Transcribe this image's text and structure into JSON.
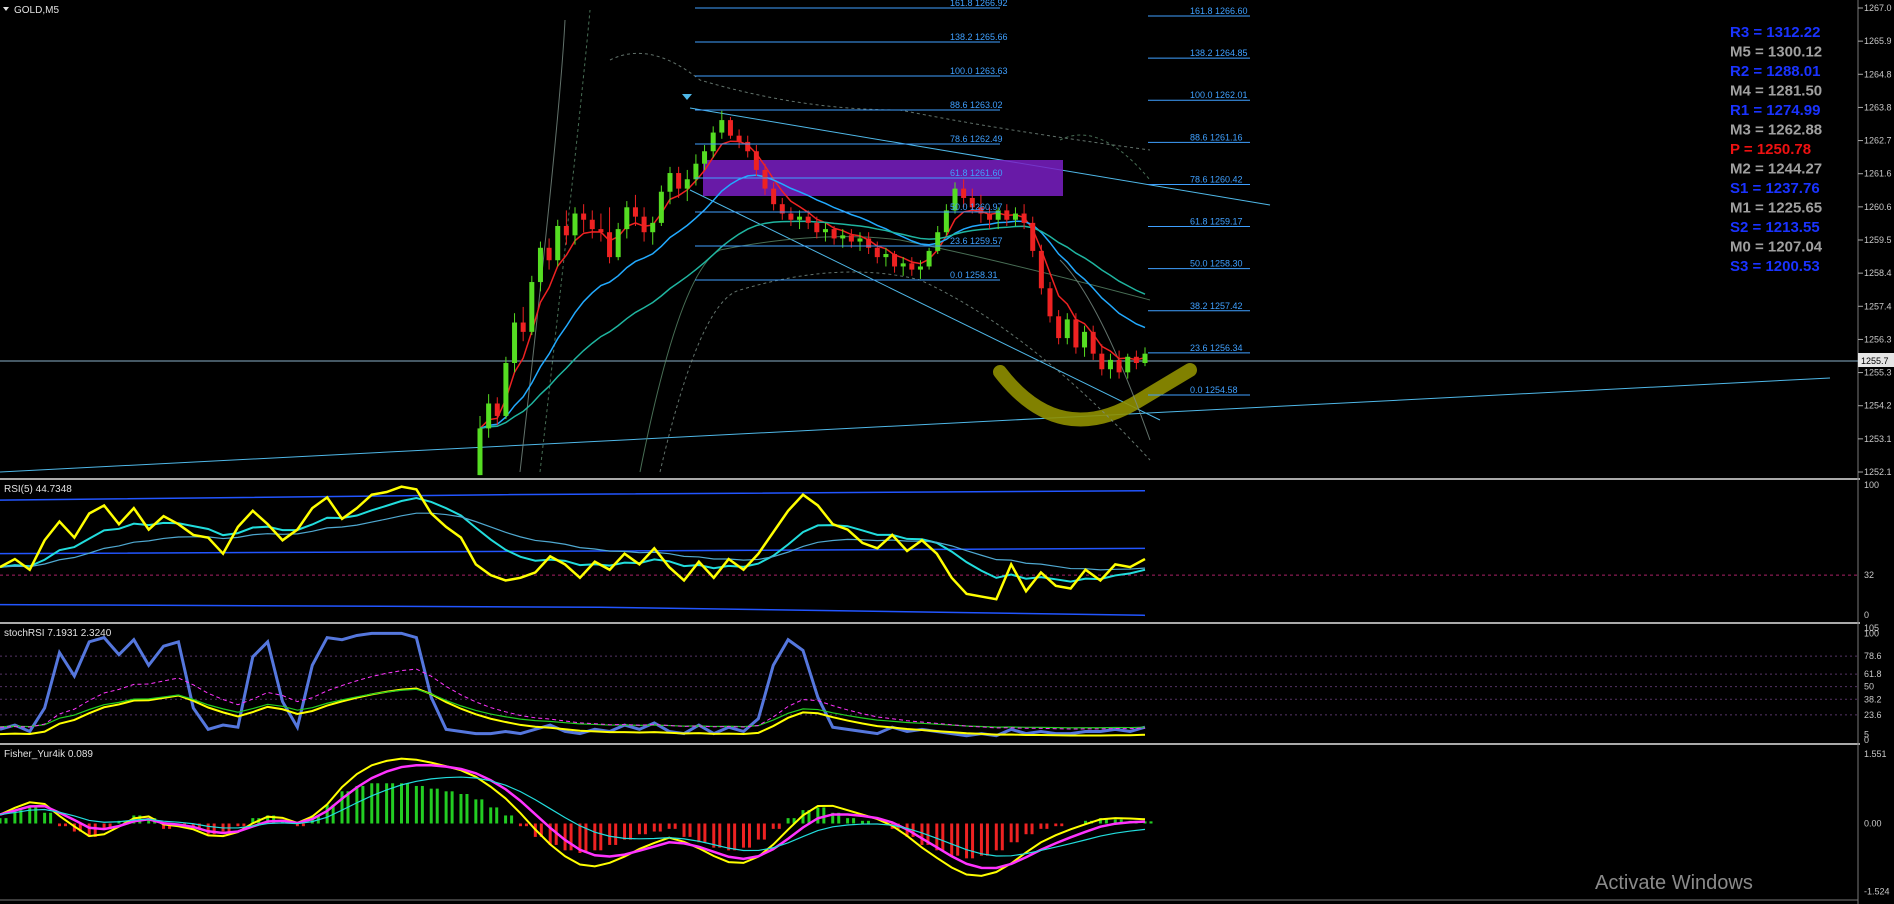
{
  "symbol": "GOLD,M5",
  "watermark": "Activate Windows",
  "colors": {
    "background": "#000000",
    "bull": "#55dd22",
    "bear": "#ee2222",
    "fib": "#3fa0ff",
    "trend": "#4fb8e8",
    "zone": "#7a1fc4",
    "marker": "#8f8f00",
    "yellow": "#ffff00",
    "magenta": "#ff33ff",
    "cyan": "#22dddd",
    "blue": "#2255ff",
    "steelblue": "#5577dd",
    "green": "#22cc22",
    "pivot_r": "#1a33ff",
    "pivot_m": "#a0a0a0",
    "pivot_p": "#ee1111",
    "pivot_s": "#1a33ff"
  },
  "price_axis": {
    "ticks": [
      "1267.0",
      "1265.9",
      "1264.8",
      "1263.8",
      "1262.7",
      "1261.6",
      "1260.6",
      "1259.5",
      "1258.4",
      "1257.4",
      "1256.3",
      "1255.3",
      "1254.2",
      "1253.1",
      "1252.1"
    ],
    "current_price": "1255.7"
  },
  "fib_set_1": [
    {
      "label": "161.8 1266.92"
    },
    {
      "label": "138.2  1265.66"
    },
    {
      "label": "100.0 1263.63"
    },
    {
      "label": "88.6 1263.02"
    },
    {
      "label": "78.6 1262.49"
    },
    {
      "label": "61.8 1261.60"
    },
    {
      "label": "50.0 1260.97"
    },
    {
      "label": "23.6 1259.57"
    },
    {
      "label": "0.0 1258.31"
    }
  ],
  "fib_set_2": [
    {
      "label": "161.8 1266.60"
    },
    {
      "label": "138.2  1264.85"
    },
    {
      "label": "100.0 1262.01"
    },
    {
      "label": "88.6 1261.16"
    },
    {
      "label": "78.6 1260.42"
    },
    {
      "label": "61.8 1259.17"
    },
    {
      "label": "50.0 1258.30"
    },
    {
      "label": "38.2 1257.42"
    },
    {
      "label": "23.6 1256.34"
    },
    {
      "label": "0.0 1254.58"
    }
  ],
  "pivots": [
    {
      "label": "R3 = 1312.22",
      "kind": "r"
    },
    {
      "label": "M5 = 1300.12",
      "kind": "m"
    },
    {
      "label": "R2 = 1288.01",
      "kind": "r"
    },
    {
      "label": "M4 = 1281.50",
      "kind": "m"
    },
    {
      "label": "R1 = 1274.99",
      "kind": "r"
    },
    {
      "label": "M3 = 1262.88",
      "kind": "m"
    },
    {
      "label": "P   = 1250.78",
      "kind": "p"
    },
    {
      "label": "M2 = 1244.27",
      "kind": "m"
    },
    {
      "label": "S1 = 1237.76",
      "kind": "s"
    },
    {
      "label": "M1 = 1225.65",
      "kind": "m"
    },
    {
      "label": "S2 = 1213.55",
      "kind": "s"
    },
    {
      "label": "M0 = 1207.04",
      "kind": "m"
    },
    {
      "label": "S3 = 1200.53",
      "kind": "s"
    }
  ],
  "rsi_pane": {
    "title": "RSI(5) 44.7348",
    "ticks": [
      "100",
      "32",
      "0"
    ]
  },
  "stoch_pane": {
    "title": "stochRSI 7.1931 2.3240",
    "ticks": [
      "105",
      "100",
      "78.6",
      "61.8",
      "50",
      "38.2",
      "23.6",
      "5",
      "0"
    ]
  },
  "fisher_pane": {
    "title": "Fisher_Yur4ik 0.089",
    "ticks": [
      "1.551",
      "0.00",
      "-1.524"
    ]
  },
  "chart_data": {
    "type": "line",
    "title": "GOLD,M5",
    "ylim": [
      1252.1,
      1267.0
    ],
    "candles": [
      [
        1252.0,
        1253.9,
        1252.0,
        1253.5
      ],
      [
        1253.5,
        1254.6,
        1253.2,
        1254.3
      ],
      [
        1254.3,
        1254.5,
        1253.6,
        1253.9
      ],
      [
        1253.9,
        1255.8,
        1253.8,
        1255.6
      ],
      [
        1255.6,
        1257.2,
        1255.3,
        1256.9
      ],
      [
        1256.9,
        1257.4,
        1256.3,
        1256.6
      ],
      [
        1256.6,
        1258.4,
        1256.5,
        1258.2
      ],
      [
        1258.2,
        1259.5,
        1257.9,
        1259.3
      ],
      [
        1259.3,
        1259.6,
        1258.6,
        1258.9
      ],
      [
        1258.9,
        1260.2,
        1258.7,
        1260.0
      ],
      [
        1260.0,
        1260.5,
        1259.4,
        1259.7
      ],
      [
        1259.7,
        1260.6,
        1259.4,
        1260.4
      ],
      [
        1260.4,
        1260.7,
        1259.8,
        1260.2
      ],
      [
        1260.2,
        1260.5,
        1259.6,
        1259.9
      ],
      [
        1259.9,
        1260.4,
        1259.5,
        1259.8
      ],
      [
        1259.8,
        1260.6,
        1258.8,
        1259.0
      ],
      [
        1259.0,
        1260.1,
        1258.9,
        1259.9
      ],
      [
        1259.9,
        1260.8,
        1259.6,
        1260.6
      ],
      [
        1260.6,
        1261.0,
        1260.0,
        1260.3
      ],
      [
        1260.3,
        1260.6,
        1259.5,
        1259.8
      ],
      [
        1259.8,
        1260.3,
        1259.4,
        1260.1
      ],
      [
        1260.1,
        1261.3,
        1260.0,
        1261.1
      ],
      [
        1261.1,
        1261.9,
        1260.7,
        1261.7
      ],
      [
        1261.7,
        1261.9,
        1260.9,
        1261.2
      ],
      [
        1261.2,
        1261.8,
        1260.8,
        1261.5
      ],
      [
        1261.5,
        1262.3,
        1261.3,
        1262.0
      ],
      [
        1262.0,
        1262.6,
        1261.8,
        1262.4
      ],
      [
        1262.4,
        1263.2,
        1262.2,
        1263.0
      ],
      [
        1263.0,
        1263.7,
        1262.8,
        1263.4
      ],
      [
        1263.4,
        1263.5,
        1262.8,
        1262.9
      ],
      [
        1262.9,
        1263.1,
        1262.5,
        1262.7
      ],
      [
        1262.7,
        1262.9,
        1262.2,
        1262.4
      ],
      [
        1262.4,
        1262.6,
        1261.6,
        1261.8
      ],
      [
        1261.8,
        1262.0,
        1261.0,
        1261.2
      ],
      [
        1261.2,
        1261.4,
        1260.5,
        1260.7
      ],
      [
        1260.7,
        1260.9,
        1260.2,
        1260.4
      ],
      [
        1260.4,
        1260.6,
        1260.0,
        1260.2
      ],
      [
        1260.2,
        1260.5,
        1259.9,
        1260.3
      ],
      [
        1260.3,
        1260.5,
        1259.9,
        1260.1
      ],
      [
        1260.1,
        1260.3,
        1259.6,
        1259.8
      ],
      [
        1259.8,
        1260.1,
        1259.5,
        1259.9
      ],
      [
        1259.9,
        1260.0,
        1259.4,
        1259.6
      ],
      [
        1259.6,
        1259.9,
        1259.3,
        1259.7
      ],
      [
        1259.7,
        1259.9,
        1259.3,
        1259.5
      ],
      [
        1259.5,
        1259.8,
        1259.2,
        1259.6
      ],
      [
        1259.6,
        1259.8,
        1259.1,
        1259.3
      ],
      [
        1259.3,
        1259.5,
        1258.8,
        1259.0
      ],
      [
        1259.0,
        1259.3,
        1258.7,
        1259.1
      ],
      [
        1259.1,
        1259.2,
        1258.5,
        1258.7
      ],
      [
        1258.7,
        1259.0,
        1258.4,
        1258.8
      ],
      [
        1258.8,
        1259.0,
        1258.4,
        1258.6
      ],
      [
        1258.6,
        1258.9,
        1258.3,
        1258.7
      ],
      [
        1258.7,
        1259.3,
        1258.6,
        1259.2
      ],
      [
        1259.2,
        1260.0,
        1259.1,
        1259.8
      ],
      [
        1259.8,
        1260.7,
        1259.7,
        1260.5
      ],
      [
        1260.5,
        1261.4,
        1260.4,
        1261.2
      ],
      [
        1261.2,
        1261.5,
        1260.6,
        1260.9
      ],
      [
        1260.9,
        1261.2,
        1260.4,
        1260.6
      ],
      [
        1260.6,
        1261.0,
        1260.1,
        1260.4
      ],
      [
        1260.4,
        1260.6,
        1259.9,
        1260.2
      ],
      [
        1260.2,
        1260.6,
        1259.9,
        1260.5
      ],
      [
        1260.5,
        1260.7,
        1260.0,
        1260.2
      ],
      [
        1260.2,
        1260.6,
        1260.0,
        1260.4
      ],
      [
        1260.4,
        1260.7,
        1259.9,
        1260.1
      ],
      [
        1260.1,
        1260.3,
        1259.0,
        1259.2
      ],
      [
        1259.2,
        1259.4,
        1257.8,
        1258.0
      ],
      [
        1258.0,
        1258.2,
        1256.9,
        1257.1
      ],
      [
        1257.1,
        1257.3,
        1256.2,
        1256.4
      ],
      [
        1256.4,
        1257.2,
        1256.2,
        1257.0
      ],
      [
        1257.0,
        1257.2,
        1255.9,
        1256.1
      ],
      [
        1256.1,
        1256.8,
        1255.8,
        1256.6
      ],
      [
        1256.6,
        1256.8,
        1255.7,
        1255.9
      ],
      [
        1255.9,
        1256.2,
        1255.2,
        1255.4
      ],
      [
        1255.4,
        1255.9,
        1255.1,
        1255.7
      ],
      [
        1255.7,
        1256.0,
        1255.1,
        1255.3
      ],
      [
        1255.3,
        1255.9,
        1255.1,
        1255.8
      ],
      [
        1255.8,
        1256.0,
        1255.4,
        1255.6
      ],
      [
        1255.6,
        1256.1,
        1255.5,
        1255.9
      ]
    ],
    "rsi": [
      38,
      44,
      36,
      58,
      72,
      60,
      78,
      84,
      70,
      82,
      66,
      76,
      70,
      62,
      60,
      48,
      68,
      80,
      70,
      58,
      66,
      82,
      90,
      74,
      82,
      92,
      94,
      98,
      96,
      78,
      68,
      60,
      40,
      32,
      28,
      30,
      34,
      46,
      40,
      30,
      42,
      36,
      48,
      40,
      52,
      38,
      28,
      42,
      30,
      44,
      36,
      48,
      64,
      80,
      92,
      84,
      70,
      66,
      56,
      52,
      62,
      50,
      58,
      48,
      30,
      18,
      16,
      14,
      40,
      20,
      34,
      24,
      22,
      36,
      28,
      40,
      38,
      44
    ],
    "stoch": [
      10,
      14,
      8,
      30,
      82,
      60,
      92,
      96,
      80,
      94,
      70,
      88,
      92,
      30,
      10,
      14,
      12,
      78,
      92,
      36,
      12,
      70,
      96,
      94,
      98,
      100,
      100,
      100,
      96,
      40,
      10,
      8,
      6,
      6,
      8,
      6,
      10,
      14,
      8,
      6,
      10,
      8,
      14,
      10,
      16,
      8,
      6,
      14,
      6,
      12,
      8,
      20,
      70,
      94,
      84,
      40,
      12,
      10,
      8,
      6,
      12,
      8,
      10,
      8,
      6,
      4,
      6,
      4,
      10,
      6,
      8,
      6,
      6,
      8,
      8,
      10,
      8,
      12
    ],
    "fisher": [
      0.2,
      0.5,
      0.6,
      0.4,
      -0.1,
      -0.3,
      -0.5,
      -0.2,
      0.1,
      0.3,
      0.2,
      -0.2,
      -0.1,
      -0.2,
      -0.4,
      -0.3,
      -0.1,
      0.2,
      0.3,
      0.1,
      -0.1,
      0.3,
      0.7,
      1.2,
      1.4,
      1.5,
      1.5,
      1.5,
      1.4,
      1.3,
      1.2,
      1.1,
      0.9,
      0.6,
      0.3,
      -0.1,
      -0.5,
      -0.8,
      -1.0,
      -1.1,
      -1.0,
      -0.8,
      -0.6,
      -0.4,
      -0.3,
      -0.2,
      -0.5,
      -0.7,
      -0.9,
      -1.0,
      -0.9,
      -0.6,
      -0.2,
      0.2,
      0.5,
      0.6,
      0.4,
      0.2,
      0.1,
      0.0,
      -0.2,
      -0.5,
      -0.8,
      -1.0,
      -1.2,
      -1.3,
      -1.2,
      -1.0,
      -0.7,
      -0.4,
      -0.2,
      -0.1,
      0.0,
      0.1,
      0.2,
      0.15,
      0.1,
      0.08
    ]
  }
}
